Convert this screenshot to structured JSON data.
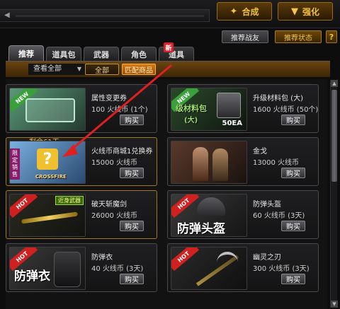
{
  "header": {
    "merge_button": "合成",
    "enhance_button": "强化"
  },
  "toolbar": {
    "record_button": "推荐战友",
    "status_button": "推荐状态",
    "help_button": "?"
  },
  "tabs": [
    {
      "label": "推荐",
      "active": true
    },
    {
      "label": "道具包",
      "active": false
    },
    {
      "label": "武器",
      "active": false
    },
    {
      "label": "角色",
      "active": false
    },
    {
      "label": "道具",
      "active": false
    }
  ],
  "new_badge": "新",
  "filter": {
    "select_value": "查看全部",
    "all_button": "全部",
    "match_button": "匹配商品"
  },
  "items": [
    {
      "name": "属性变更券",
      "price": "100 火线币 (1个)",
      "buy": "购买",
      "tag": "NEW"
    },
    {
      "name": "升级材料包 (大)",
      "price": "1600 火线币 (50个)",
      "buy": "购买",
      "tag": "NEW",
      "thumb_text": "级材料包",
      "thumb_sub": "(大)",
      "ea": "50EA"
    },
    {
      "name": "火线币商城1兑换券",
      "price": "15000 火线币",
      "buy": "购买",
      "days": "剩余61天",
      "side_label": "限定销售",
      "thumb_brand": "CROSSFIRE"
    },
    {
      "name": "金戈",
      "price": "13000 火线币",
      "buy": "购买"
    },
    {
      "name": "破天斩魔剑",
      "price": "26000 火线币",
      "buy": "购买",
      "tag": "HOT",
      "gold_label": "近身武器"
    },
    {
      "name": "防弹头盔",
      "price": "60 火线币 (3天)",
      "buy": "购买",
      "tag": "HOT",
      "thumb_text": "防弹头盔"
    },
    {
      "name": "防弹衣",
      "price": "40 火线币 (3天)",
      "buy": "购买",
      "tag": "HOT",
      "thumb_text": "防弹衣"
    },
    {
      "name": "幽灵之刃",
      "price": "300 火线币 (3天)",
      "buy": "购买",
      "tag": "HOT"
    }
  ],
  "colors": {
    "accent_gold": "#f0c040",
    "filter_bar": "#6a4510",
    "arrow": "#e02020",
    "new_tag": "#3aa03a",
    "hot_tag": "#d02020"
  }
}
